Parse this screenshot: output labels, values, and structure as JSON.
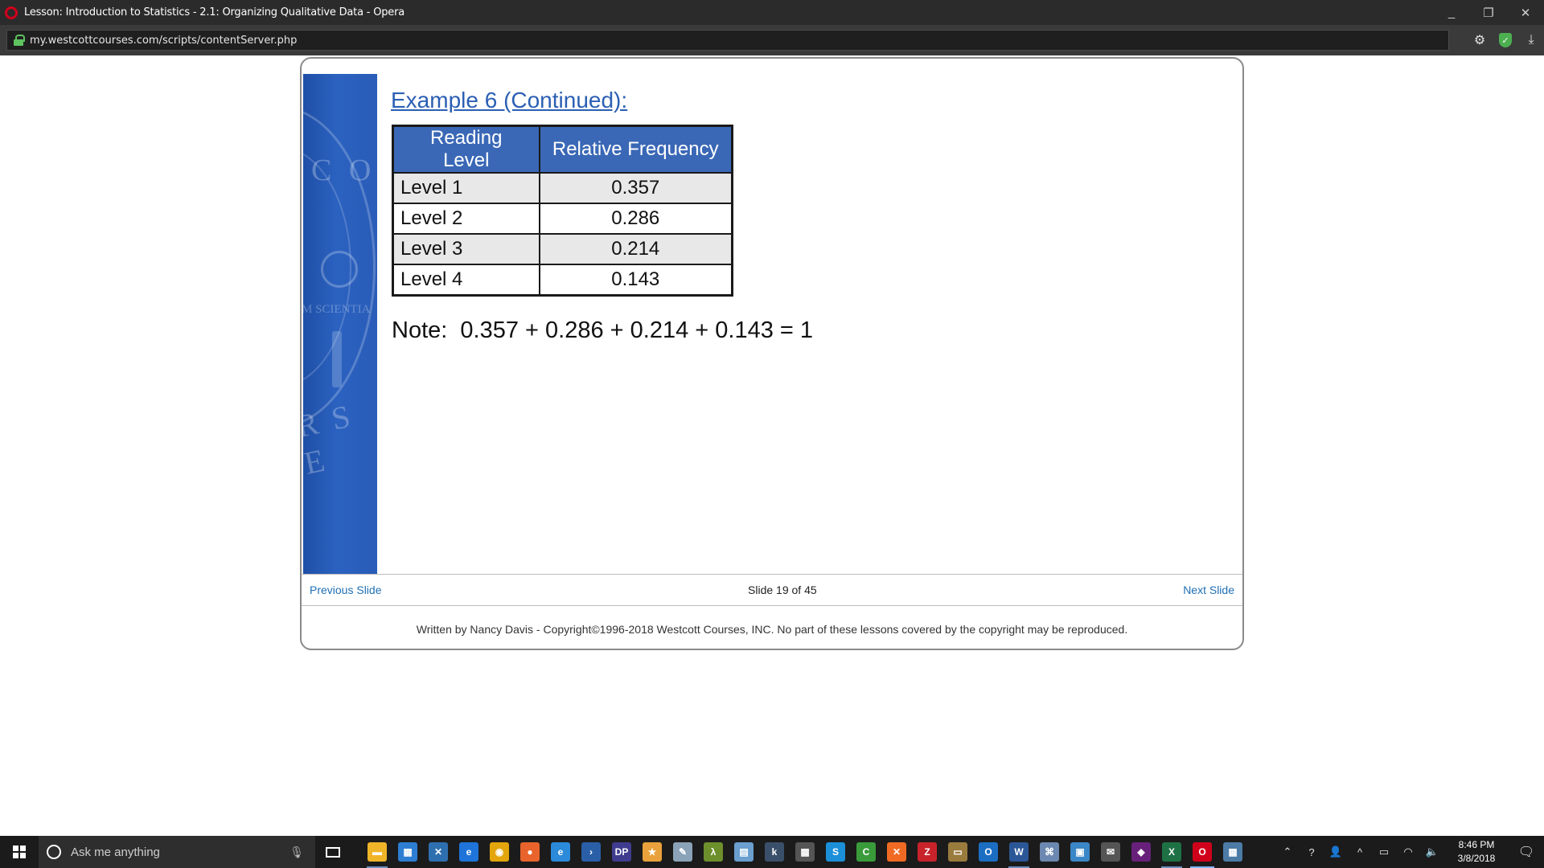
{
  "window": {
    "title": "Lesson: Introduction to Statistics - 2.1: Organizing Qualitative Data - Opera",
    "minimize": "_",
    "restore": "❐",
    "close": "✕"
  },
  "address_bar": {
    "url": "my.westcottcourses.com/scripts/contentServer.php"
  },
  "slide": {
    "title": "Example 6 (Continued):",
    "table": {
      "headers": [
        "Reading Level",
        "Relative Frequency"
      ],
      "rows": [
        [
          "Level 1",
          "0.357"
        ],
        [
          "Level 2",
          "0.286"
        ],
        [
          "Level 3",
          "0.214"
        ],
        [
          "Level 4",
          "0.143"
        ]
      ]
    },
    "note": "Note:  0.357 + 0.286 + 0.214 + 0.143 = 1",
    "seal_text": {
      "top": "C O",
      "middle": "M SCIENTIA",
      "bottom": "R S E"
    }
  },
  "navigation": {
    "previous": "Previous Slide",
    "counter": "Slide 19 of 45",
    "next": "Next Slide"
  },
  "footer": {
    "copyright": "Written by Nancy Davis - Copyright©1996-2018 Westcott Courses, INC. No part of these lessons covered by the copyright may be reproduced."
  },
  "taskbar": {
    "search_placeholder": "Ask me anything",
    "apps": [
      {
        "name": "file-explorer-icon",
        "color": "#f0b429",
        "glyph": "▬"
      },
      {
        "name": "store-icon",
        "color": "#2d7dd2",
        "glyph": "▦"
      },
      {
        "name": "visual-studio-installer-icon",
        "color": "#2e6fb0",
        "glyph": "✕"
      },
      {
        "name": "edge-icon",
        "color": "#1e74d9",
        "glyph": "e"
      },
      {
        "name": "chrome-icon",
        "color": "#e2a50b",
        "glyph": "◉"
      },
      {
        "name": "firefox-icon",
        "color": "#e8642c",
        "glyph": "●"
      },
      {
        "name": "internet-explorer-icon",
        "color": "#2b8ad9",
        "glyph": "e"
      },
      {
        "name": "powershell-icon",
        "color": "#2a5fa8",
        "glyph": "›"
      },
      {
        "name": "dreamweaver-icon",
        "color": "#3f3c8f",
        "glyph": "DP"
      },
      {
        "name": "star-app-icon",
        "color": "#e9a23b",
        "glyph": "★"
      },
      {
        "name": "paint-icon",
        "color": "#8aa3b8",
        "glyph": "✎"
      },
      {
        "name": "lambda-app-icon",
        "color": "#6d8f2c",
        "glyph": "λ"
      },
      {
        "name": "notes-app-icon",
        "color": "#6a9fcf",
        "glyph": "▤"
      },
      {
        "name": "kindle-icon",
        "color": "#3a4f6a",
        "glyph": "k"
      },
      {
        "name": "calculator-icon",
        "color": "#555555",
        "glyph": "▦"
      },
      {
        "name": "skype-icon",
        "color": "#1b8fd8",
        "glyph": "S"
      },
      {
        "name": "camtasia-icon",
        "color": "#3a9b3a",
        "glyph": "C"
      },
      {
        "name": "xampp-icon",
        "color": "#f06a24",
        "glyph": "✕"
      },
      {
        "name": "filezilla-icon",
        "color": "#c8232b",
        "glyph": "Z"
      },
      {
        "name": "presentation-app-icon",
        "color": "#9a7b3e",
        "glyph": "▭"
      },
      {
        "name": "outlook-icon",
        "color": "#1b6ec2",
        "glyph": "O"
      },
      {
        "name": "word-icon",
        "color": "#2b5797",
        "glyph": "W"
      },
      {
        "name": "network-app-icon",
        "color": "#6c88b0",
        "glyph": "⌘"
      },
      {
        "name": "remote-desktop-icon",
        "color": "#3b86c6",
        "glyph": "▣"
      },
      {
        "name": "mail-icon",
        "color": "#555555",
        "glyph": "✉"
      },
      {
        "name": "visual-studio-icon",
        "color": "#68217a",
        "glyph": "◆"
      },
      {
        "name": "excel-icon",
        "color": "#1e7145",
        "glyph": "X"
      },
      {
        "name": "opera-icon",
        "color": "#d0021b",
        "glyph": "O"
      },
      {
        "name": "tablet-app-icon",
        "color": "#4c7ba6",
        "glyph": "▦"
      }
    ],
    "clock_time": "8:46 PM",
    "clock_date": "3/8/2018"
  }
}
